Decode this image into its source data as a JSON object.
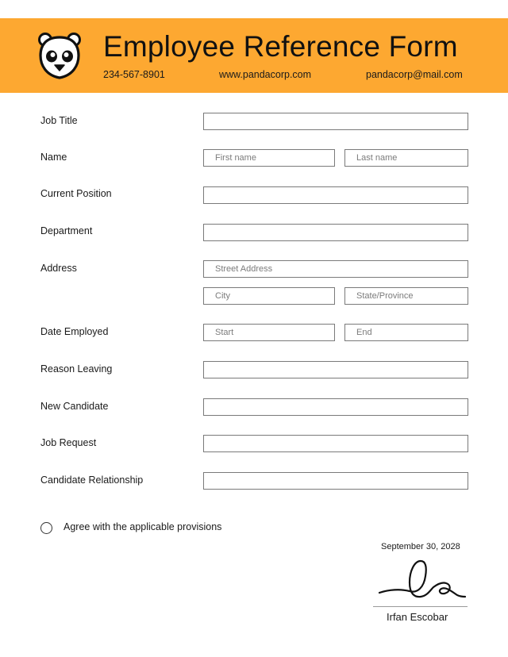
{
  "header": {
    "title": "Employee Reference Form",
    "phone": "234-567-8901",
    "website": "www.pandacorp.com",
    "email": "pandacorp@mail.com",
    "logo_icon": "panda-icon",
    "banner_color": "#FDA831"
  },
  "form": {
    "fields": [
      {
        "label": "Job Title",
        "inputs": [
          {
            "placeholder": "",
            "value": ""
          }
        ]
      },
      {
        "label": "Name",
        "inputs": [
          {
            "placeholder": "First name",
            "value": ""
          },
          {
            "placeholder": "Last name",
            "value": ""
          }
        ]
      },
      {
        "label": "Current Position",
        "inputs": [
          {
            "placeholder": "",
            "value": ""
          }
        ]
      },
      {
        "label": "Department",
        "inputs": [
          {
            "placeholder": "",
            "value": ""
          }
        ]
      },
      {
        "label": "Address",
        "inputs": [
          {
            "placeholder": "Street Address",
            "value": ""
          },
          {
            "placeholder": "City",
            "value": ""
          },
          {
            "placeholder": "State/Province",
            "value": ""
          }
        ]
      },
      {
        "label": "Date Employed",
        "inputs": [
          {
            "placeholder": "Start",
            "value": ""
          },
          {
            "placeholder": "End",
            "value": ""
          }
        ]
      },
      {
        "label": "Reason Leaving",
        "inputs": [
          {
            "placeholder": "",
            "value": ""
          }
        ]
      },
      {
        "label": "New Candidate",
        "inputs": [
          {
            "placeholder": "",
            "value": ""
          }
        ]
      },
      {
        "label": "Job Request",
        "inputs": [
          {
            "placeholder": "",
            "value": ""
          }
        ]
      },
      {
        "label": "Candidate Relationship",
        "inputs": [
          {
            "placeholder": "",
            "value": ""
          }
        ]
      }
    ],
    "agreement": {
      "label": "Agree with the applicable provisions",
      "checked": false
    }
  },
  "signature": {
    "date": "September 30, 2028",
    "name": "Irfan Escobar"
  }
}
